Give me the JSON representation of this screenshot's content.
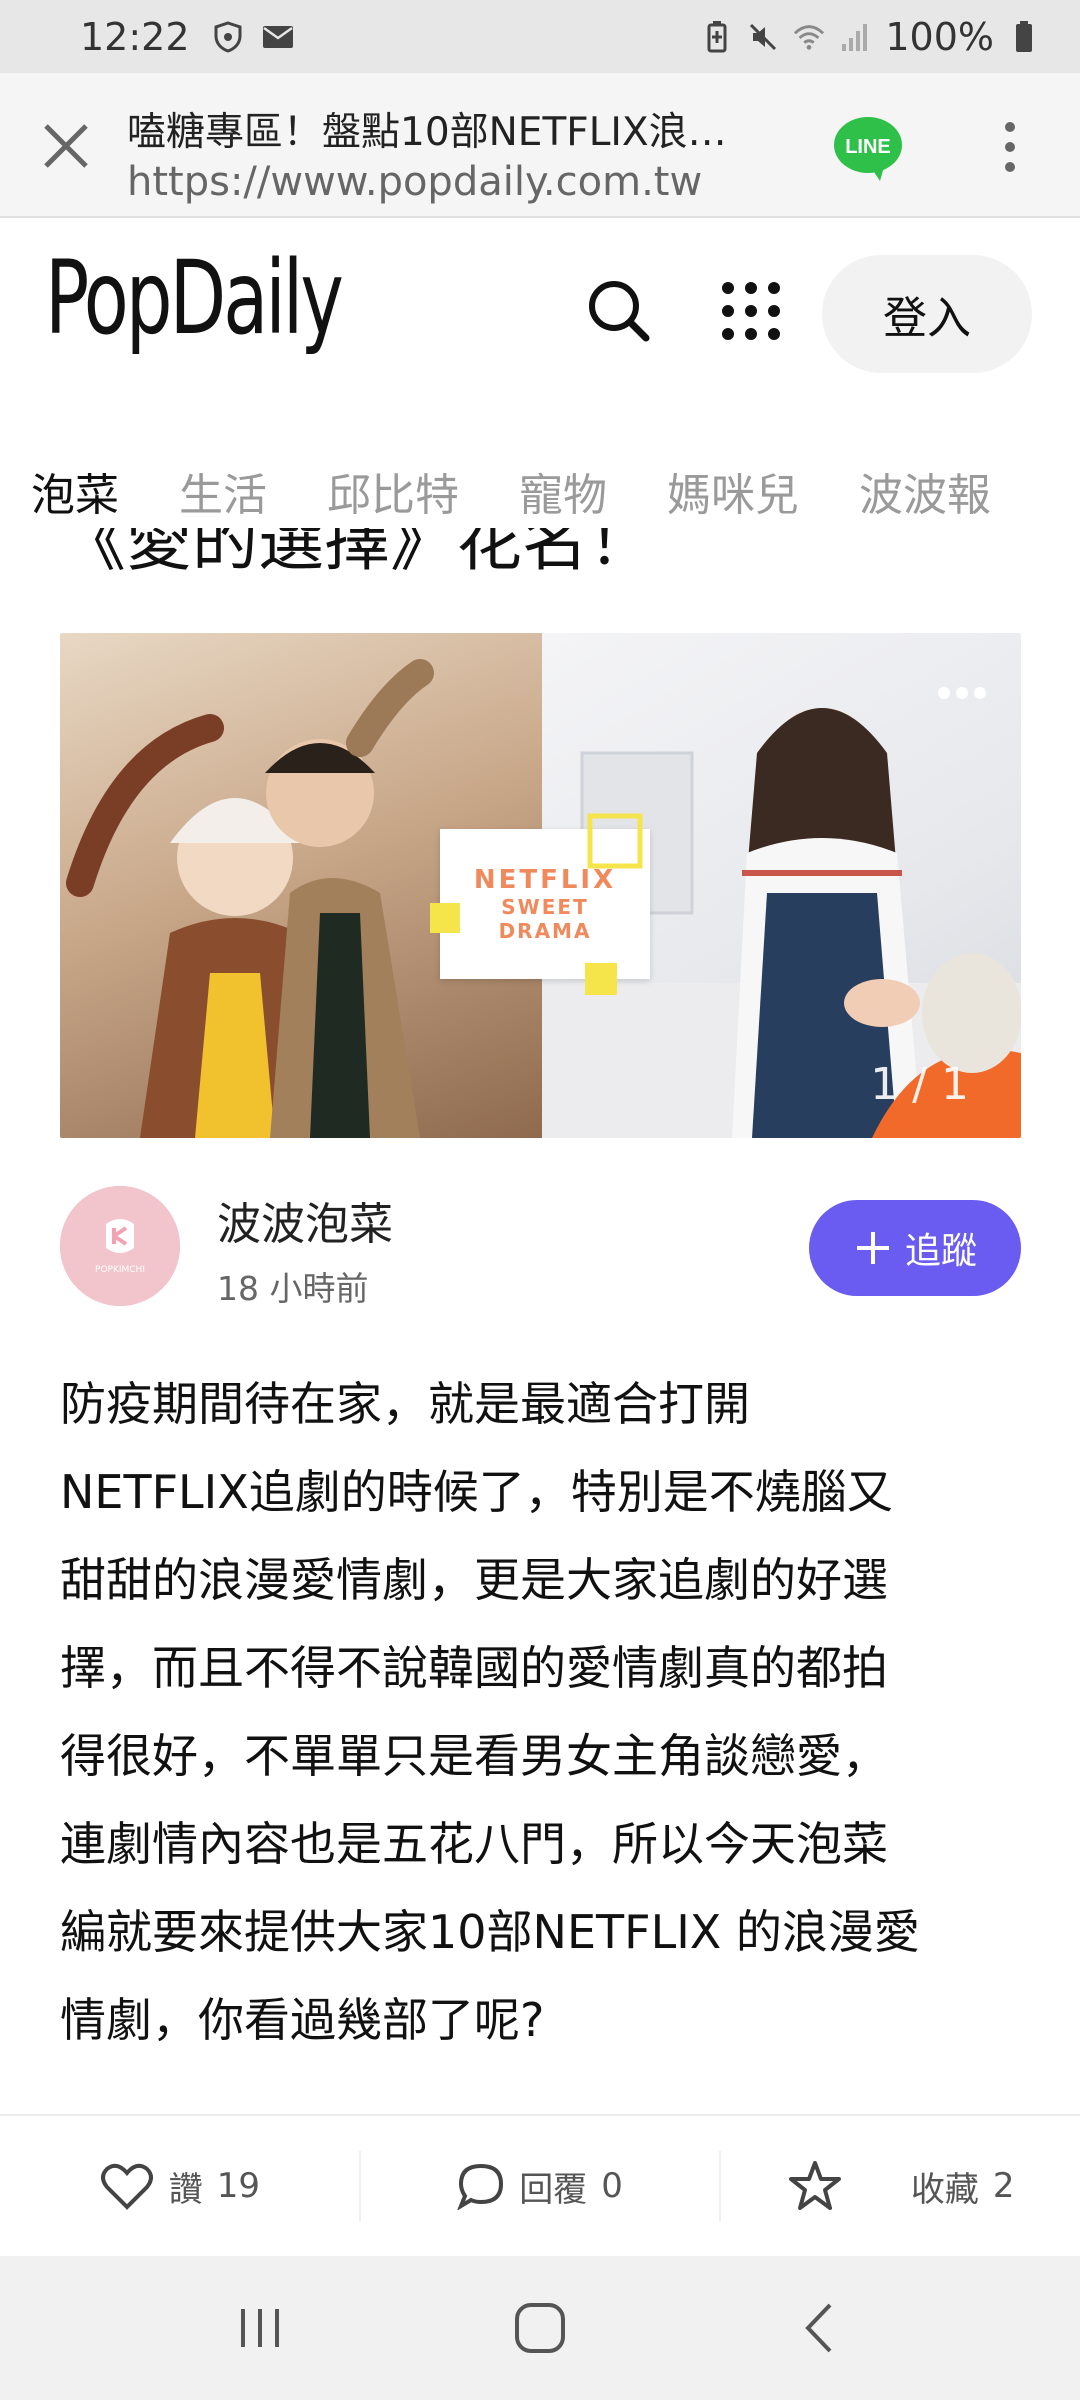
{
  "status_bar": {
    "time": "12:22",
    "battery": "100%",
    "left_icons": [
      "shield-icon",
      "mail-icon"
    ],
    "right_icons": [
      "battery-saver-icon",
      "mute-icon",
      "wifi-icon",
      "signal-icon",
      "battery-icon"
    ]
  },
  "browser": {
    "page_title": "嗑糖專區！盤點10部NETFLIX浪…",
    "url": "https://www.popdaily.com.tw",
    "share_label": "LINE"
  },
  "site": {
    "logo": "PopDaily",
    "login_label": "登入"
  },
  "tabs": [
    {
      "label": "泡菜",
      "active": true
    },
    {
      "label": "生活",
      "active": false
    },
    {
      "label": "邱比特",
      "active": false
    },
    {
      "label": "寵物",
      "active": false
    },
    {
      "label": "媽咪兒",
      "active": false
    },
    {
      "label": "波波報",
      "active": false
    }
  ],
  "article": {
    "title_fragment": "《愛的選擇》花名！",
    "image": {
      "badge_line1": "NETFLIX",
      "badge_line2": "SWEET",
      "badge_line3": "DRAMA",
      "counter": "1 / 1"
    },
    "author": {
      "name": "波波泡菜",
      "time": "18 小時前",
      "avatar_text": "POPKIMCHI",
      "follow_label": "追蹤"
    },
    "lines": [
      "防疫期間待在家，就是最適合打開",
      "NETFLIX追劇的時候了，特別是不燒腦又",
      "甜甜的浪漫愛情劇，更是大家追劇的好選",
      "擇，而且不得不說韓國的愛情劇真的都拍",
      "得很好，不單單只是看男女主角談戀愛，",
      "連劇情內容也是五花八門，所以今天泡菜",
      "編就要來提供大家10部NETFLIX 的浪漫愛",
      "情劇，你看過幾部了呢?"
    ]
  },
  "actions": {
    "like_label": "讚",
    "like_count": "19",
    "reply_label": "回覆",
    "reply_count": "0",
    "save_label": "收藏",
    "save_count": "2"
  },
  "colors": {
    "accent": "#6a5cf0",
    "line_green": "#2fc04a",
    "status_bar_bg": "#e7e7e7"
  }
}
